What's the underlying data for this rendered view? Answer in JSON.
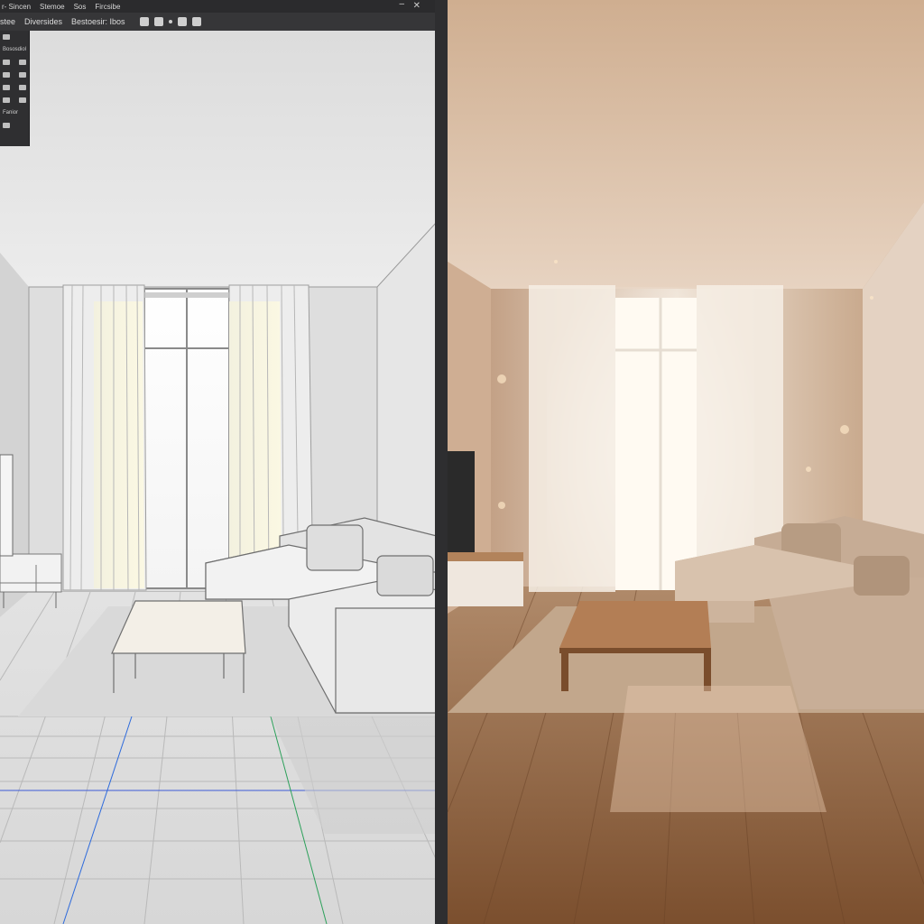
{
  "menubar": {
    "items": [
      "r- Sincen",
      "Stemoe",
      "Sos",
      "Fircsibe"
    ]
  },
  "toolbar": {
    "labels": [
      "stee",
      "Diversides",
      "Bestoesir: Ibos"
    ]
  },
  "tools": {
    "rows": [
      {
        "label": "",
        "icon": "cube-icon"
      },
      {
        "label": "Bososdiol",
        "icon": "layer-icon"
      },
      {
        "label": "",
        "icon": "pen-icon"
      },
      {
        "label": "",
        "icon": "brush-icon"
      },
      {
        "label": "",
        "icon": "cut-icon"
      },
      {
        "label": "",
        "icon": "grid-icon"
      },
      {
        "label": "",
        "icon": "gear-icon"
      },
      {
        "label": "Fanior",
        "icon": "settings-icon"
      }
    ]
  },
  "colors": {
    "ui_dark": "#2b2b2d",
    "wall": "#e8e8e8",
    "floor_wood": "#8a5a38",
    "warm_wall": "#c9a88c"
  }
}
